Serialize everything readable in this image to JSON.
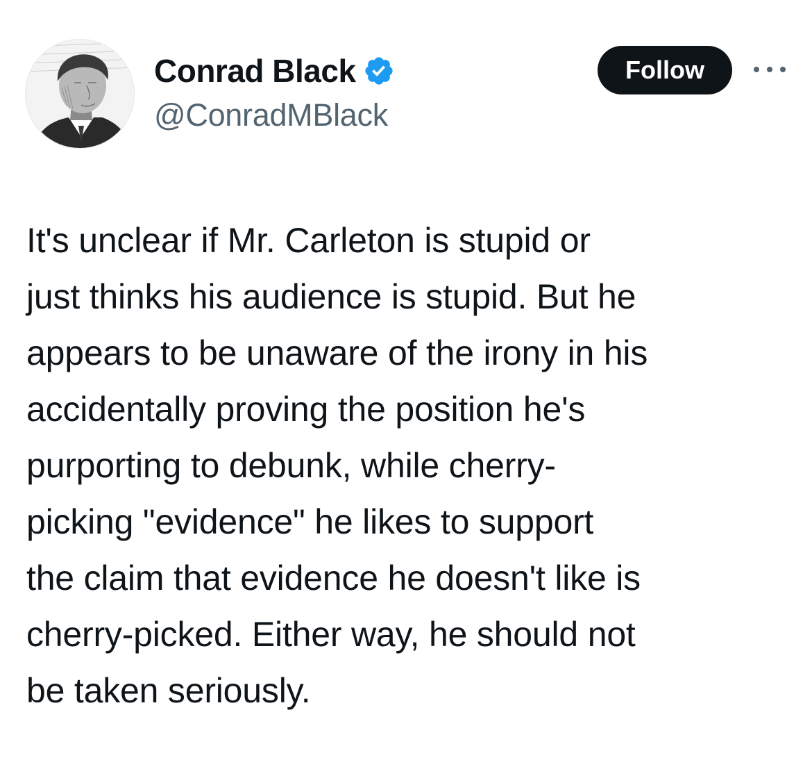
{
  "author": {
    "display_name": "Conrad Black",
    "handle": "@ConradMBlack",
    "verified": true,
    "verified_color": "#1d9bf0"
  },
  "actions": {
    "follow_label": "Follow"
  },
  "tweet": {
    "lines": [
      "It's unclear if Mr. Carleton is stupid or",
      "just thinks his audience is stupid. But he",
      "appears to be unaware of the irony in his",
      "accidentally proving the position he's",
      "purporting to debunk, while cherry-",
      "picking \"evidence\" he likes to support",
      "the claim that evidence he doesn't like is",
      "cherry-picked. Either way, he should not",
      "be taken seriously."
    ]
  },
  "icons": {
    "verified": "verified-badge-icon",
    "more": "more-options-icon"
  }
}
